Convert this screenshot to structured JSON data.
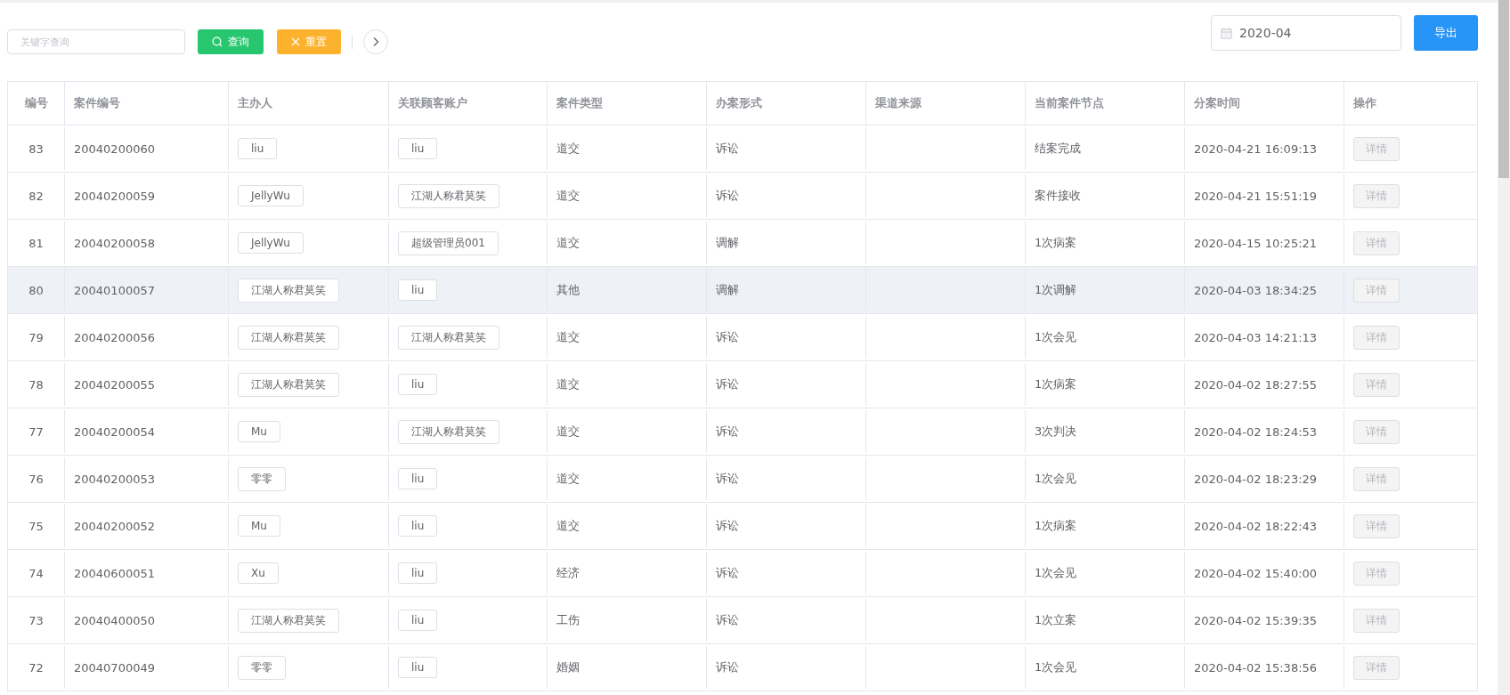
{
  "toolbar": {
    "search": {
      "placeholder": "关键字查询"
    },
    "query_button": "查询",
    "reset_button": "重置",
    "date_field": {
      "value": "2020-04"
    },
    "export_button": "导出"
  },
  "table": {
    "columns": [
      "编号",
      "案件编号",
      "主办人",
      "关联顾客账户",
      "案件类型",
      "办案形式",
      "渠道来源",
      "当前案件节点",
      "分案时间",
      "操作"
    ],
    "rows": [
      {
        "id": "83",
        "case_no": "20040200060",
        "handler": "liu",
        "account": "liu",
        "type": "道交",
        "form": "诉讼",
        "channel": "",
        "node": "结案完成",
        "time": "2020-04-21 16:09:13",
        "action": "详情",
        "disabled": true,
        "highlighted": false
      },
      {
        "id": "82",
        "case_no": "20040200059",
        "handler": "JellyWu",
        "account": "江湖人称君莫笑",
        "type": "道交",
        "form": "诉讼",
        "channel": "",
        "node": "案件接收",
        "time": "2020-04-21 15:51:19",
        "action": "详情",
        "disabled": true,
        "highlighted": false
      },
      {
        "id": "81",
        "case_no": "20040200058",
        "handler": "JellyWu",
        "account": "超级管理员001",
        "type": "道交",
        "form": "调解",
        "channel": "",
        "node": "1次病案",
        "time": "2020-04-15 10:25:21",
        "action": "详情",
        "disabled": true,
        "highlighted": false
      },
      {
        "id": "80",
        "case_no": "20040100057",
        "handler": "江湖人称君莫笑",
        "account": "liu",
        "type": "其他",
        "form": "调解",
        "channel": "",
        "node": "1次调解",
        "time": "2020-04-03 18:34:25",
        "action": "详情",
        "disabled": true,
        "highlighted": true
      },
      {
        "id": "79",
        "case_no": "20040200056",
        "handler": "江湖人称君莫笑",
        "account": "江湖人称君莫笑",
        "type": "道交",
        "form": "诉讼",
        "channel": "",
        "node": "1次会见",
        "time": "2020-04-03 14:21:13",
        "action": "详情",
        "disabled": true,
        "highlighted": false
      },
      {
        "id": "78",
        "case_no": "20040200055",
        "handler": "江湖人称君莫笑",
        "account": "liu",
        "type": "道交",
        "form": "诉讼",
        "channel": "",
        "node": "1次病案",
        "time": "2020-04-02 18:27:55",
        "action": "详情",
        "disabled": true,
        "highlighted": false
      },
      {
        "id": "77",
        "case_no": "20040200054",
        "handler": "Mu",
        "account": "江湖人称君莫笑",
        "type": "道交",
        "form": "诉讼",
        "channel": "",
        "node": "3次判决",
        "time": "2020-04-02 18:24:53",
        "action": "详情",
        "disabled": true,
        "highlighted": false
      },
      {
        "id": "76",
        "case_no": "20040200053",
        "handler": "零零",
        "account": "liu",
        "type": "道交",
        "form": "诉讼",
        "channel": "",
        "node": "1次会见",
        "time": "2020-04-02 18:23:29",
        "action": "详情",
        "disabled": true,
        "highlighted": false
      },
      {
        "id": "75",
        "case_no": "20040200052",
        "handler": "Mu",
        "account": "liu",
        "type": "道交",
        "form": "诉讼",
        "channel": "",
        "node": "1次病案",
        "time": "2020-04-02 18:22:43",
        "action": "详情",
        "disabled": true,
        "highlighted": false
      },
      {
        "id": "74",
        "case_no": "20040600051",
        "handler": "Xu",
        "account": "liu",
        "type": "经济",
        "form": "诉讼",
        "channel": "",
        "node": "1次会见",
        "time": "2020-04-02 15:40:00",
        "action": "详情",
        "disabled": true,
        "highlighted": false
      },
      {
        "id": "73",
        "case_no": "20040400050",
        "handler": "江湖人称君莫笑",
        "account": "liu",
        "type": "工伤",
        "form": "诉讼",
        "channel": "",
        "node": "1次立案",
        "time": "2020-04-02 15:39:35",
        "action": "详情",
        "disabled": true,
        "highlighted": false
      },
      {
        "id": "72",
        "case_no": "20040700049",
        "handler": "零零",
        "account": "liu",
        "type": "婚姻",
        "form": "诉讼",
        "channel": "",
        "node": "1次会见",
        "time": "2020-04-02 15:38:56",
        "action": "详情",
        "disabled": true,
        "highlighted": false
      }
    ]
  }
}
